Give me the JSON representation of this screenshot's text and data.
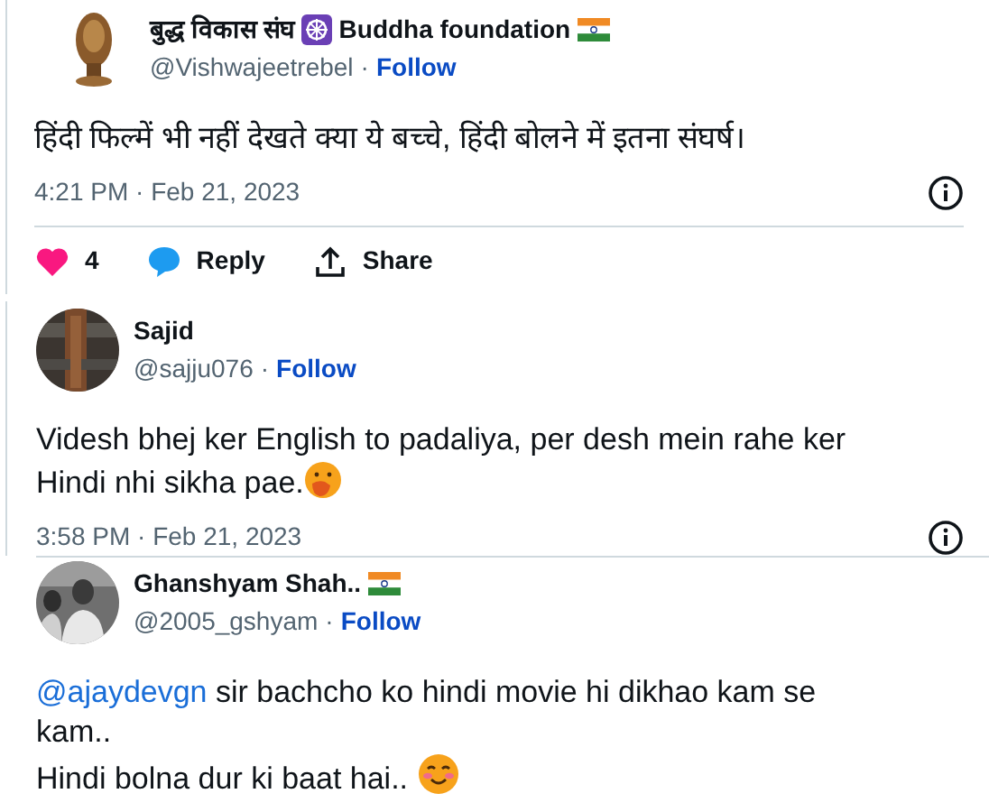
{
  "tweets": [
    {
      "name": "बुद्ध विकास संघ",
      "badges": [
        {
          "kind": "wheel"
        },
        {
          "kind": "flag"
        }
      ],
      "after_badge": "Buddha foundation",
      "handle": "@Vishwajeetrebel",
      "separator": "·",
      "follow": "Follow",
      "lines": [
        [
          {
            "kind": "text",
            "text": "हिंदी फिल्में भी नहीं देखते क्या ये बच्चे, हिंदी बोलने में इतना संघर्ष।"
          }
        ]
      ],
      "time": "4:21 PM · Feb 21, 2023",
      "actions": [
        {
          "kind": "like",
          "label": "4"
        },
        {
          "kind": "reply",
          "label": "Reply"
        },
        {
          "kind": "share",
          "label": "Share"
        }
      ]
    },
    {
      "name": "Sajid",
      "handle": "@sajju076",
      "separator": "·",
      "follow": "Follow",
      "lines": [
        [
          {
            "kind": "text",
            "text": "Videsh bhej ker English to padaliya, per desh mein rahe ker"
          }
        ],
        [
          {
            "kind": "text",
            "text": "Hindi nhi sikha pae."
          },
          {
            "kind": "hush"
          }
        ]
      ],
      "time": "3:58 PM · Feb 21, 2023"
    },
    {
      "name": "Ghanshyam Shah..",
      "badges": [
        {
          "kind": "flag"
        }
      ],
      "handle": "@2005_gshyam",
      "separator": "·",
      "follow": "Follow",
      "lines": [
        [
          {
            "kind": "mention",
            "text": "@ajaydevgn"
          },
          {
            "kind": "text",
            "text": " sir bachcho ko hindi movie hi dikhao kam se"
          }
        ],
        [
          {
            "kind": "text",
            "text": "kam.."
          }
        ],
        [
          {
            "kind": "text",
            "text": "Hindi bolna dur ki baat hai.. "
          },
          {
            "kind": "smile"
          }
        ]
      ]
    }
  ]
}
